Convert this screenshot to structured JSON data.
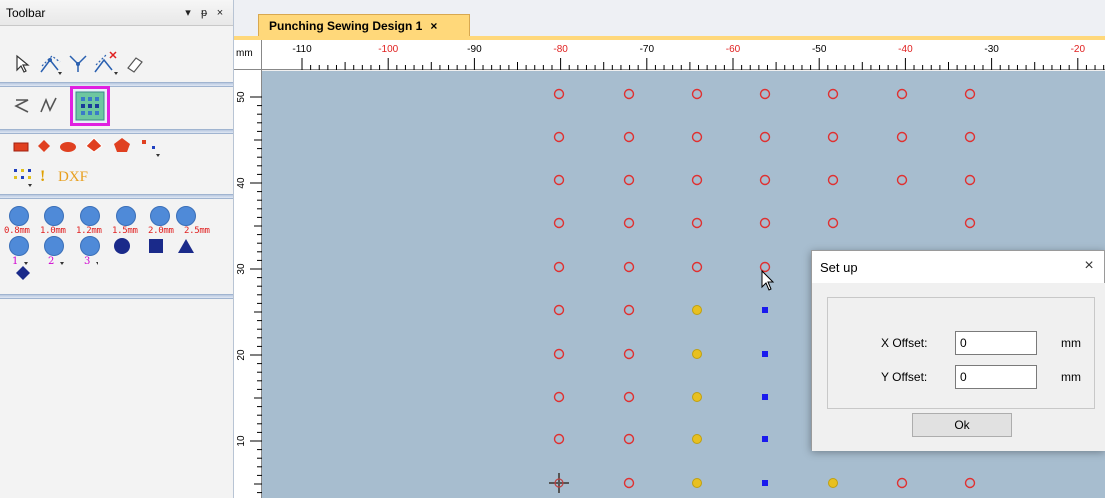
{
  "toolbar": {
    "title": "Toolbar",
    "header_buttons": [
      "▾",
      "ᵽ",
      "×"
    ],
    "dxf_label": "DXF",
    "exclaim_label": "!",
    "size_labels": [
      "0.8mm",
      "1.0mm",
      "1.2mm",
      "1.5mm",
      "2.0mm",
      "2.5mm"
    ],
    "number_labels": [
      "1",
      "2",
      "3"
    ]
  },
  "document": {
    "tab_title": "Punching Sewing Design 1",
    "tab_close": "×"
  },
  "rulers": {
    "unit": "mm",
    "top_ticks": [
      "-110",
      "-100",
      "-90",
      "-80",
      "-70",
      "-60",
      "-50",
      "-40",
      "-30",
      "-20"
    ],
    "left_ticks": [
      "50",
      "40",
      "30",
      "20",
      "10"
    ]
  },
  "colors": {
    "canvas_bg": "#a7bdcf",
    "hole_red": "#e03030",
    "hole_yellow": "#e8c020",
    "marker_blue": "#1a1aee",
    "highlight_magenta": "#e020e0",
    "tab_gold": "#ffd87a"
  },
  "dialog": {
    "title": "Set up",
    "close": "×",
    "x_label": "X Offset:",
    "x_value": "0",
    "y_label": "Y Offset:",
    "y_value": "0",
    "unit": "mm",
    "ok_label": "Ok"
  }
}
